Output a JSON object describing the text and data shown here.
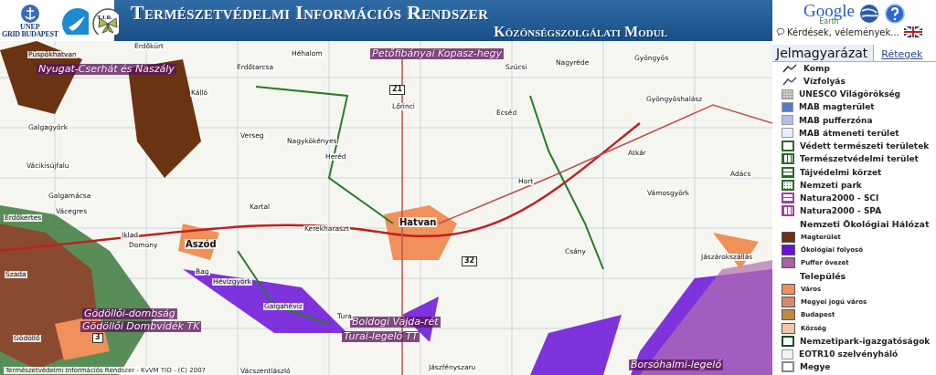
{
  "header": {
    "logos": [
      {
        "kind": "unep",
        "lines": [
          "UNEP",
          "GRID BUDAPEST"
        ]
      },
      {
        "kind": "bird"
      },
      {
        "kind": "tir",
        "lines": [
          "T.I.R."
        ]
      }
    ],
    "title": "Természetvédelmi Információs Rendszer",
    "subtitle": "Közönségszolgálati Modul"
  },
  "tools": {
    "google": "Google",
    "earth": "Earth",
    "feedback": "Kérdések, vélemények..."
  },
  "tabs": [
    {
      "label": "Jelmagyarázat",
      "selected": true
    },
    {
      "label": "Rétegek",
      "selected": false
    }
  ],
  "legend": [
    {
      "kind": "line",
      "label": "Komp",
      "color": "#222222"
    },
    {
      "kind": "line",
      "label": "Vízfolyás",
      "color": "#3a3a6a"
    },
    {
      "kind": "grid",
      "label": "UNESCO Világörökség",
      "color": "#d8d8d8"
    },
    {
      "kind": "fill",
      "label": "MAB magterület",
      "color": "#5a78d0"
    },
    {
      "kind": "fill",
      "label": "MAB pufferzóna",
      "color": "#b4bee6"
    },
    {
      "kind": "fill",
      "label": "MAB átmeneti terület",
      "color": "#e6ecfa"
    },
    {
      "kind": "outline",
      "label": "Védett természeti területek",
      "color": "#2c6a2c"
    },
    {
      "kind": "hatch-v",
      "label": "Természetvédelmi terület",
      "color": "#2c6a2c"
    },
    {
      "kind": "hatch-h",
      "label": "Tájvédelmi körzet",
      "color": "#2c6a2c"
    },
    {
      "kind": "dots",
      "label": "Nemzeti park",
      "color": "#2c6a2c"
    },
    {
      "kind": "hatch-h",
      "label": "Natura2000 - SCI",
      "color": "#a040a0"
    },
    {
      "kind": "hatch-v",
      "label": "Natura2000 - SPA",
      "color": "#a040a0"
    },
    {
      "kind": "heading",
      "label": "Nemzeti Ökológiai Hálózat"
    },
    {
      "kind": "small",
      "label": "Magterület",
      "color": "#6a3412"
    },
    {
      "kind": "small",
      "label": "Ökológiai folyosó",
      "color": "#6a10d8"
    },
    {
      "kind": "small",
      "label": "Puffer övezet",
      "color": "#a860a0"
    },
    {
      "kind": "heading",
      "label": "Település"
    },
    {
      "kind": "small",
      "label": "Város",
      "color": "#f0905a"
    },
    {
      "kind": "small",
      "label": "Megyei jogú város",
      "color": "#d88870"
    },
    {
      "kind": "small",
      "label": "Budapest",
      "color": "#c08a40"
    },
    {
      "kind": "small",
      "label": "Község",
      "color": "#f4c4a8"
    },
    {
      "kind": "outline",
      "label": "Nemzetipark-igazgatóságok",
      "color": "#1e4a1e"
    },
    {
      "kind": "fill",
      "label": "EOTR10 szelvényháló",
      "color": "#eef2f6"
    },
    {
      "kind": "outline",
      "label": "Megye",
      "color": "#888888"
    }
  ],
  "map": {
    "credit": "Természetvédelmi Információs Rendszer - KvVM TIO - (C) 2007",
    "labels": [
      {
        "kind": "area",
        "text": "Nyugat-Cserhát és Naszály"
      },
      {
        "kind": "area",
        "text": "Petőfibányai Kopasz-hegy"
      },
      {
        "kind": "area",
        "text": "Gödöllői-dombság"
      },
      {
        "kind": "area",
        "text": "Gödöllői Dombvidék TK"
      },
      {
        "kind": "area",
        "text": "Boldogi Vajda-rét"
      },
      {
        "kind": "area",
        "text": "Turai-legelő TT"
      },
      {
        "kind": "area",
        "text": "Borsóhalmi-legelő"
      },
      {
        "kind": "town",
        "text": "Püspökhatvan"
      },
      {
        "kind": "town",
        "text": "Erdőkürt"
      },
      {
        "kind": "town",
        "text": "Héhalom"
      },
      {
        "kind": "town",
        "text": "Szúcsi"
      },
      {
        "kind": "town",
        "text": "Nagyréde"
      },
      {
        "kind": "town",
        "text": "Gyöngyös"
      },
      {
        "kind": "town",
        "text": "Erdőtarcsa"
      },
      {
        "kind": "town",
        "text": "Kálló"
      },
      {
        "kind": "town",
        "text": "Lőrinci"
      },
      {
        "kind": "town",
        "text": "Ecséd"
      },
      {
        "kind": "town",
        "text": "Gyöngyöshalász"
      },
      {
        "kind": "town",
        "text": "Galgagyörk"
      },
      {
        "kind": "town",
        "text": "Nagykökényes"
      },
      {
        "kind": "town",
        "text": "Verseg"
      },
      {
        "kind": "town",
        "text": "Atkár"
      },
      {
        "kind": "town",
        "text": "Vácikisújfalu"
      },
      {
        "kind": "town",
        "text": "Heréd"
      },
      {
        "kind": "town",
        "text": "Hort"
      },
      {
        "kind": "town",
        "text": "Galgamácsa"
      },
      {
        "kind": "town",
        "text": "Kartal"
      },
      {
        "kind": "town",
        "text": "Adács"
      },
      {
        "kind": "town",
        "text": "Vámosgyörk"
      },
      {
        "kind": "town",
        "text": "Vácegres"
      },
      {
        "kind": "town",
        "text": "Kerekharaszt"
      },
      {
        "kind": "city",
        "text": "Hatvan"
      },
      {
        "kind": "town",
        "text": "Erdőkertes"
      },
      {
        "kind": "town",
        "text": "Iklad"
      },
      {
        "kind": "town",
        "text": "Domony"
      },
      {
        "kind": "city",
        "text": "Aszód"
      },
      {
        "kind": "town",
        "text": "Csány"
      },
      {
        "kind": "town",
        "text": "Jászárokszállás"
      },
      {
        "kind": "town",
        "text": "Bag"
      },
      {
        "kind": "town",
        "text": "Szada"
      },
      {
        "kind": "town",
        "text": "Hévízgyörk"
      },
      {
        "kind": "town",
        "text": "Galgahévíz"
      },
      {
        "kind": "town",
        "text": "Tura"
      },
      {
        "kind": "town",
        "text": "Gödöllő"
      },
      {
        "kind": "town",
        "text": "Vácszentlászló"
      },
      {
        "kind": "town",
        "text": "Jászfényszaru"
      },
      {
        "kind": "road",
        "text": "21"
      },
      {
        "kind": "road",
        "text": "32"
      },
      {
        "kind": "road",
        "text": "3"
      }
    ]
  }
}
